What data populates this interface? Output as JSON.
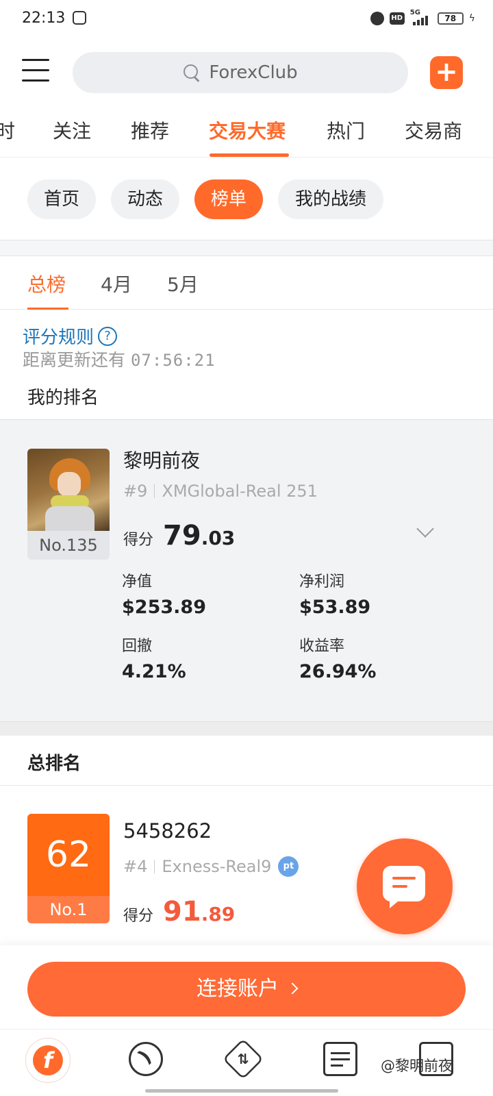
{
  "status_bar": {
    "time": "22:13",
    "hd": "HD",
    "network": "5G",
    "battery": "78"
  },
  "header": {
    "search_placeholder": "ForexClub",
    "menu_icon": "menu-icon",
    "add_icon": "plus-icon"
  },
  "top_tabs": [
    {
      "label": "时"
    },
    {
      "label": "关注"
    },
    {
      "label": "推荐"
    },
    {
      "label": "交易大赛",
      "active": true
    },
    {
      "label": "热门"
    },
    {
      "label": "交易商"
    }
  ],
  "sub_tabs": [
    {
      "label": "首页"
    },
    {
      "label": "动态"
    },
    {
      "label": "榜单",
      "active": true
    },
    {
      "label": "我的战绩"
    }
  ],
  "period_tabs": [
    {
      "label": "总榜",
      "active": true
    },
    {
      "label": "4月"
    },
    {
      "label": "5月"
    }
  ],
  "rules": {
    "link_label": "评分规则",
    "help_glyph": "?",
    "countdown_label": "距离更新还有",
    "countdown_time": "07:56:21"
  },
  "my_rank": {
    "section_label": "我的排名",
    "rank_label": "No.135",
    "name": "黎明前夜",
    "position": "#9",
    "account": "XMGlobal-Real 251",
    "score_label": "得分",
    "score_int": "79",
    "score_dec": ".03",
    "stats": [
      {
        "label": "净值",
        "value": "$253.89"
      },
      {
        "label": "净利润",
        "value": "$53.89"
      },
      {
        "label": "回撤",
        "value": "4.21%"
      },
      {
        "label": "收益率",
        "value": "26.94%"
      }
    ]
  },
  "overall": {
    "title": "总排名",
    "entries": [
      {
        "avatar_text": "62",
        "rank_label": "No.1",
        "name": "5458262",
        "position": "#4",
        "account": "Exness-Real9",
        "badge": "pt",
        "score_label": "得分",
        "score_int": "91",
        "score_dec": ".89"
      }
    ]
  },
  "cta": {
    "label": "连接账户"
  },
  "bottom_nav": {
    "home_glyph": "f",
    "items": [
      "home-icon",
      "feed-icon",
      "trade-icon",
      "news-icon",
      "profile-icon"
    ]
  },
  "watermark": "@黎明前夜",
  "colors": {
    "accent": "#ff6a2b",
    "link": "#1d75b8",
    "score_highlight": "#f45a3c"
  }
}
